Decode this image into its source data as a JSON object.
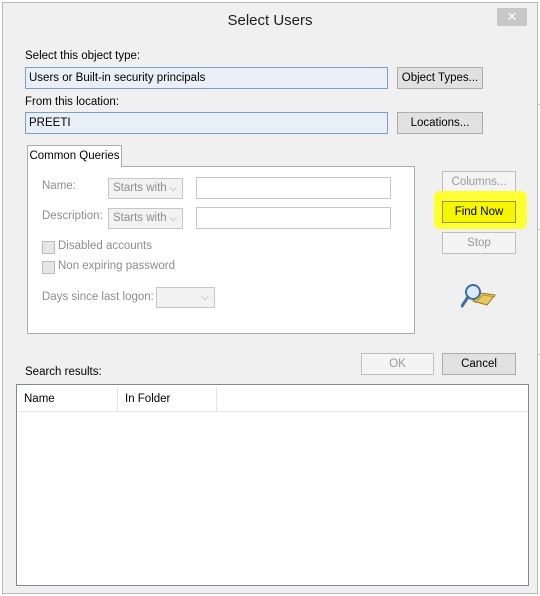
{
  "dialog": {
    "title": "Select Users",
    "close_symbol": "✕"
  },
  "object_type": {
    "label": "Select this object type:",
    "value": "Users or Built-in security principals",
    "button": "Object Types..."
  },
  "location": {
    "label": "From this location:",
    "value": "PREETI",
    "button": "Locations..."
  },
  "common_queries": {
    "tab_label": "Common Queries",
    "name_label": "Name:",
    "name_mode": "Starts with",
    "description_label": "Description:",
    "description_mode": "Starts with",
    "disabled_accounts": "Disabled accounts",
    "non_expiring_password": "Non expiring password",
    "days_since_logon_label": "Days since last logon:",
    "days_since_logon_value": ""
  },
  "side_buttons": {
    "columns": "Columns...",
    "find_now": "Find Now",
    "stop": "Stop"
  },
  "actions": {
    "ok": "OK",
    "cancel": "Cancel"
  },
  "results": {
    "label": "Search results:",
    "columns": [
      "Name",
      "In Folder"
    ],
    "rows": []
  },
  "colors": {
    "highlight": "#ffff33",
    "field_background": "#e8eff7"
  },
  "icons": {
    "search_icon": "magnifier-over-folder",
    "dropdown_icon": "chevron-down-icon"
  }
}
